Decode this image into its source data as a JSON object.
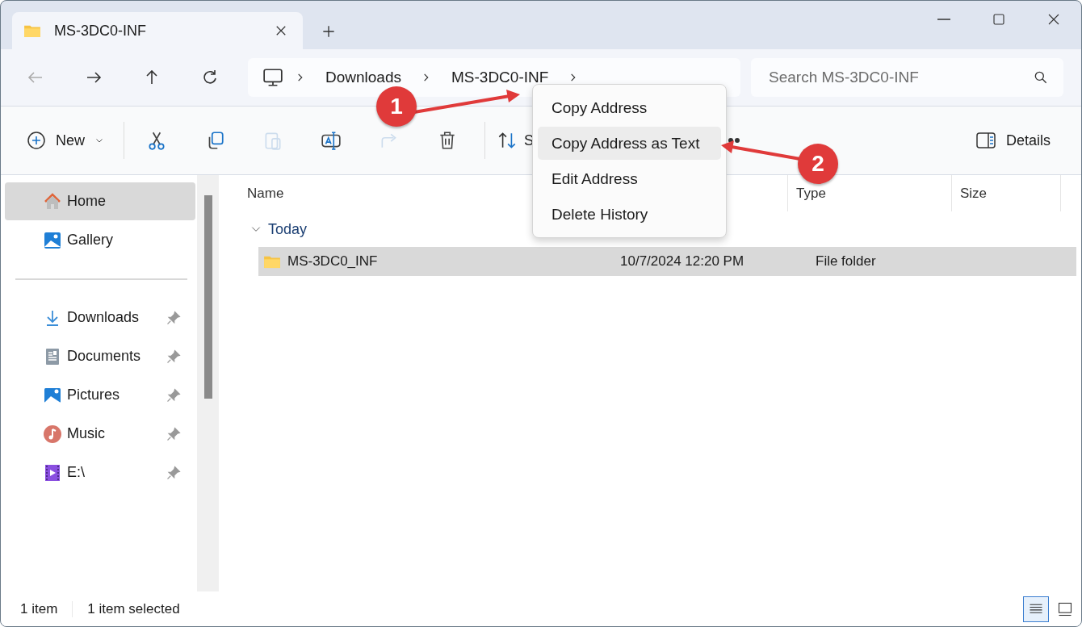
{
  "window": {
    "tab_title": "MS-3DC0-INF"
  },
  "address_bar": {
    "crumbs": [
      "Downloads",
      "MS-3DC0-INF"
    ]
  },
  "search": {
    "placeholder": "Search MS-3DC0-INF"
  },
  "toolbar": {
    "new_label": "New",
    "icon_buttons": [
      {
        "disabled": false
      },
      {
        "disabled": false
      },
      {
        "disabled": true
      },
      {
        "disabled": false
      },
      {
        "disabled": true
      },
      {
        "disabled": false
      }
    ],
    "sort_label": "S",
    "details_label": "Details"
  },
  "sidebar": {
    "items": [
      {
        "label": "Home",
        "selected": true,
        "pinned": false
      },
      {
        "label": "Gallery",
        "selected": false,
        "pinned": false
      },
      {
        "label": "Downloads",
        "selected": false,
        "pinned": true
      },
      {
        "label": "Documents",
        "selected": false,
        "pinned": true
      },
      {
        "label": "Pictures",
        "selected": false,
        "pinned": true
      },
      {
        "label": "Music",
        "selected": false,
        "pinned": true
      },
      {
        "label": "E:\\",
        "selected": false,
        "pinned": true
      }
    ]
  },
  "table": {
    "columns": [
      "Name",
      "Type",
      "Size"
    ],
    "group": {
      "label": "Today",
      "expanded": true
    },
    "rows": [
      {
        "name": "MS-3DC0_INF",
        "date": "10/7/2024 12:20 PM",
        "type": "File folder",
        "selected": true
      }
    ]
  },
  "context_menu": {
    "items": [
      {
        "label": "Copy Address",
        "selected": false
      },
      {
        "label": "Copy Address as Text",
        "selected": true
      },
      {
        "label": "Edit Address",
        "selected": false
      },
      {
        "label": "Delete History",
        "selected": false
      }
    ]
  },
  "annotations": [
    "1",
    "2"
  ],
  "status_bar": {
    "count": "1 item",
    "selection": "1 item selected",
    "view_buttons": [
      {
        "selected": true
      },
      {
        "selected": false
      }
    ]
  }
}
